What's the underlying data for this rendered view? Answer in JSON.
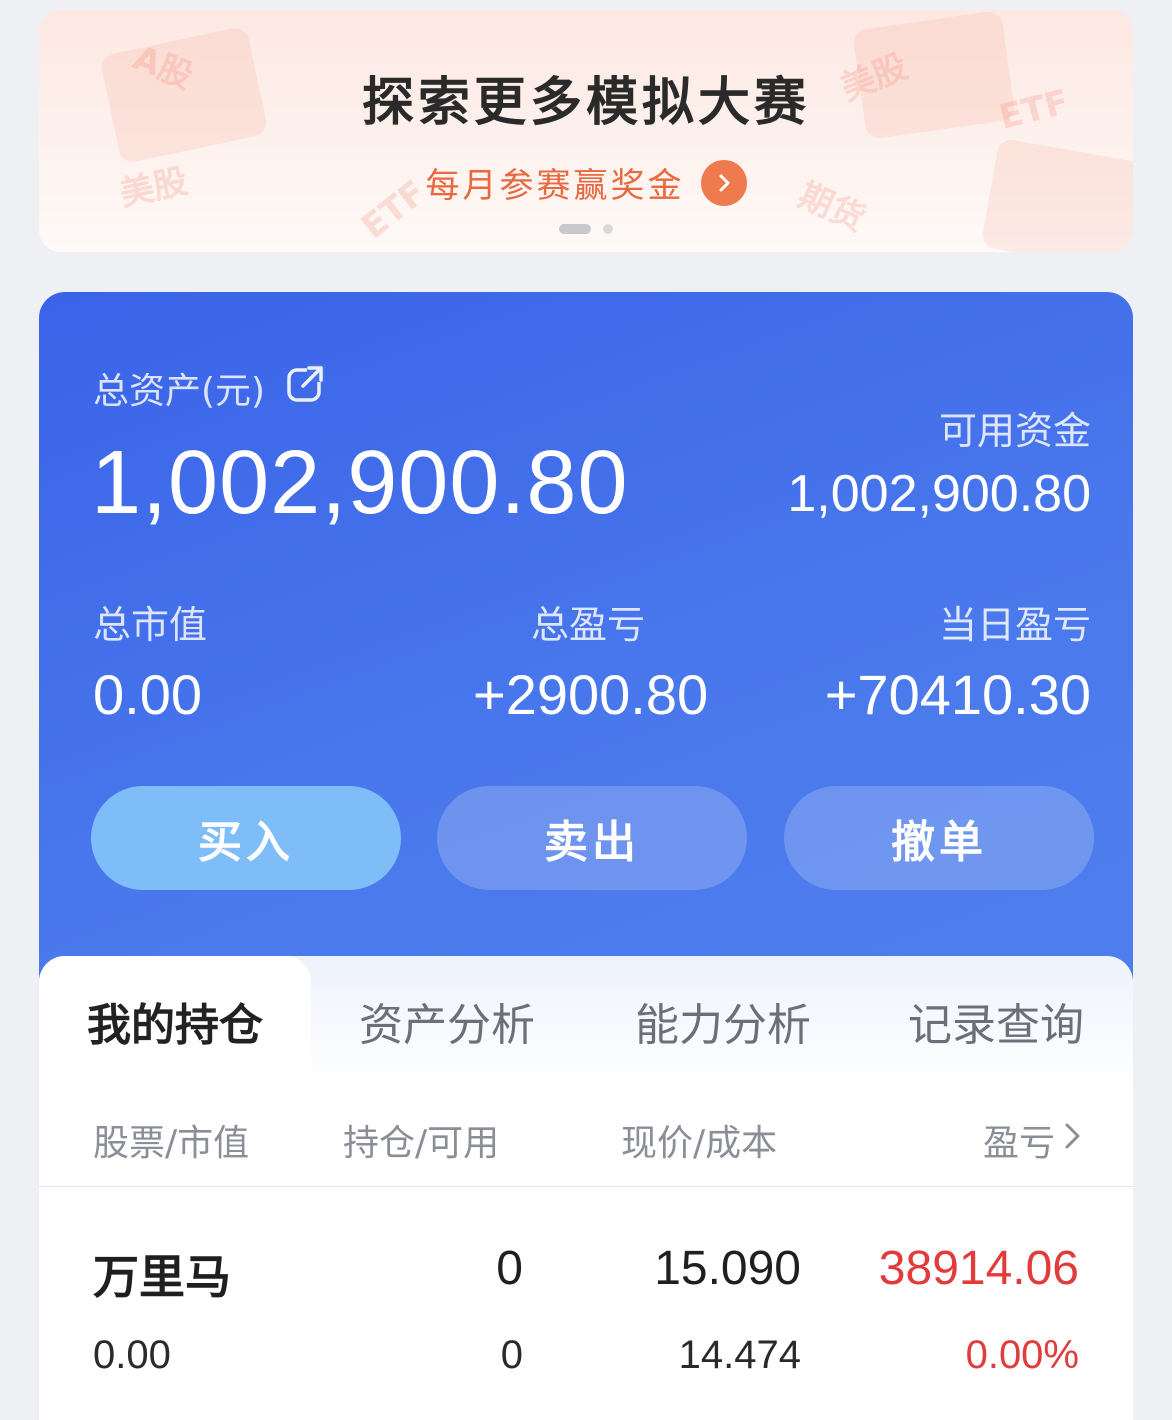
{
  "banner": {
    "title": "探索更多模拟大赛",
    "subtitle": "每月参赛赢奖金",
    "deco_tags": [
      "A股",
      "美股",
      "ETF",
      "美股",
      "ETF",
      "期货"
    ],
    "arrow_icon": "chevron-right-icon"
  },
  "assets": {
    "total_label": "总资产(元)",
    "total_value": "1,002,900.80",
    "available_label": "可用资金",
    "available_value": "1,002,900.80",
    "market_value_label": "总市值",
    "market_value": "0.00",
    "total_pnl_label": "总盈亏",
    "total_pnl": "+2900.80",
    "daily_pnl_label": "当日盈亏",
    "daily_pnl": "+70410.30"
  },
  "actions": {
    "buy": "买入",
    "sell": "卖出",
    "cancel": "撤单"
  },
  "tabs": [
    "我的持仓",
    "资产分析",
    "能力分析",
    "记录查询"
  ],
  "holdings": {
    "headers": [
      "股票/市值",
      "持仓/可用",
      "现价/成本",
      "盈亏"
    ],
    "rows": [
      {
        "name": "万里马",
        "market_value": "0.00",
        "position": "0",
        "available": "0",
        "price": "15.090",
        "cost": "14.474",
        "pnl": "38914.06",
        "pnl_pct": "0.00%"
      }
    ]
  },
  "colors": {
    "card_blue": "#3a63e8",
    "buy_button": "#7fbdf9",
    "accent_orange": "#ee7a4e",
    "profit_red": "#e23b3b"
  }
}
